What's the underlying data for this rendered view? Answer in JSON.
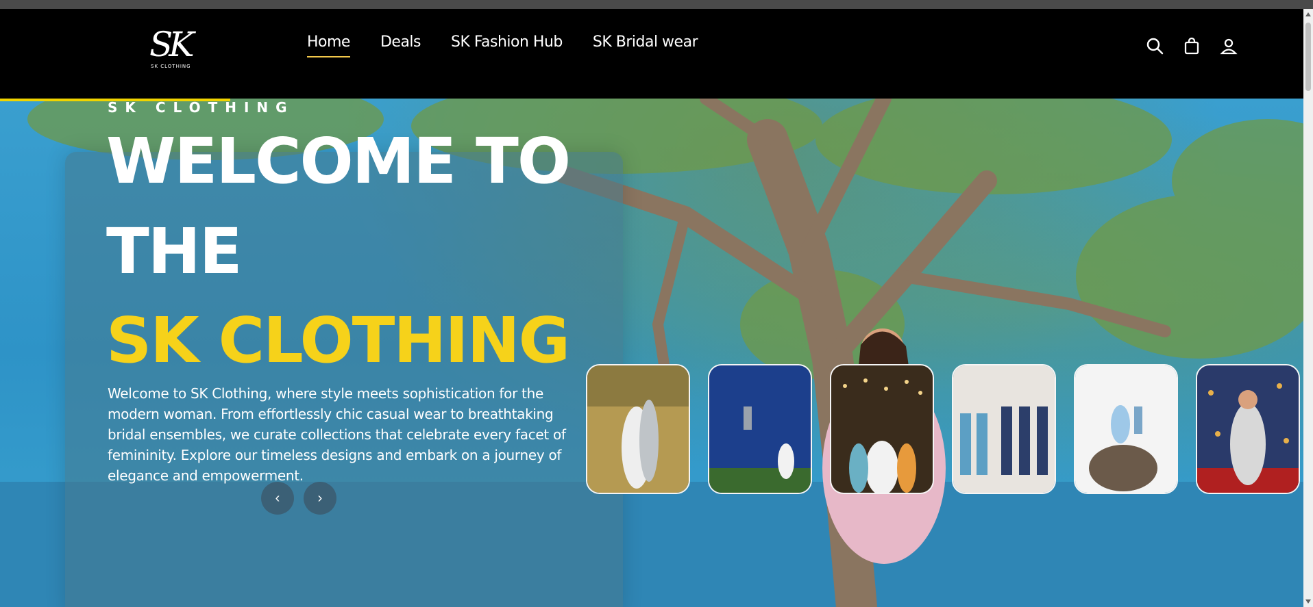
{
  "brand": {
    "logo_mark": "SK",
    "logo_sub": "SK CLOTHING"
  },
  "nav": [
    {
      "label": "Home",
      "active": true
    },
    {
      "label": "Deals",
      "active": false
    },
    {
      "label": "SK Fashion Hub",
      "active": false
    },
    {
      "label": "SK Bridal wear",
      "active": false
    }
  ],
  "header_icons": [
    "search-icon",
    "shopping-bag-icon",
    "user-icon"
  ],
  "hero": {
    "eyebrow": "SK CLOTHING",
    "title_line1": "WELCOME TO",
    "title_line2": "THE",
    "title_line3": "SK CLOTHING",
    "intro": "Welcome to SK Clothing, where style meets sophistication for the modern woman. From effortlessly chic casual wear to breathtaking bridal ensembles, we curate collections that celebrate every facet of femininity. Explore our timeless designs and embark on a journey of elegance and empowerment.",
    "prev_label": "‹",
    "next_label": "›"
  },
  "colors": {
    "accent_yellow": "#f6d21a",
    "nav_underline": "#f2c84b",
    "header_bg": "#000000"
  }
}
